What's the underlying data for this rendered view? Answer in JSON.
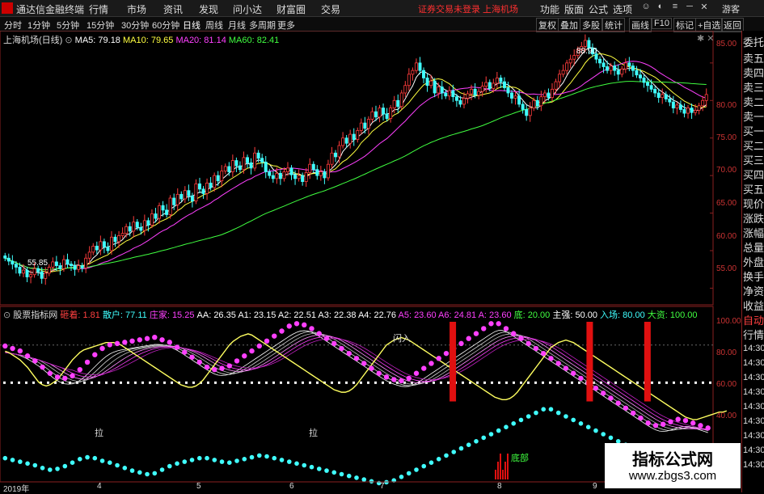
{
  "app": {
    "title": "通达信金融终端",
    "menu": [
      "行情",
      "市场",
      "资讯",
      "发现",
      "问小达",
      "财富圈",
      "交易"
    ],
    "alert": "证券交易未登录 上海机场",
    "menu_right": [
      "功能",
      "版面",
      "公式",
      "选项"
    ],
    "guest": "游客"
  },
  "toolbar": {
    "periods": [
      "分时",
      "1分钟",
      "5分钟",
      "15分钟",
      "30分钟",
      "60分钟",
      "日线",
      "周线",
      "月线",
      "多周期",
      "更多"
    ],
    "right": [
      "复权",
      "叠加",
      "多股",
      "统计",
      "画线",
      "F10",
      "标记",
      "+自选",
      "返回"
    ]
  },
  "main": {
    "title": "上海机场(日线)",
    "ma": [
      {
        "label": "MA5: 79.18",
        "color": "#ffffff"
      },
      {
        "label": "MA10: 79.65",
        "color": "#ffff40"
      },
      {
        "label": "MA20: 81.14",
        "color": "#ff40ff"
      },
      {
        "label": "MA60: 82.41",
        "color": "#40ff40"
      }
    ],
    "high_label": "88.90",
    "low_label": "55.85",
    "yticks": [
      "85.00",
      "80.00",
      "75.00",
      "70.00",
      "65.00",
      "60.00",
      "55.00"
    ]
  },
  "indicator": {
    "name": "股票指标网",
    "labels": [
      {
        "text": "砸着: 1.81",
        "color": "#ff4040"
      },
      {
        "text": "散户: 77.11",
        "color": "#40ffff"
      },
      {
        "text": "庄家: 15.25",
        "color": "#ff40ff"
      },
      {
        "text": "AA: 26.35",
        "color": "#ffffff"
      },
      {
        "text": "A1: 23.15",
        "color": "#ffffff"
      },
      {
        "text": "A2: 22.51",
        "color": "#ffffff"
      },
      {
        "text": "A3: 22.38",
        "color": "#ffffff"
      },
      {
        "text": "A4: 22.76",
        "color": "#ffffff"
      },
      {
        "text": "A5: 23.60",
        "color": "#ff40ff"
      },
      {
        "text": "A6: 24.81",
        "color": "#ff40ff"
      },
      {
        "text": "A: 23.60",
        "color": "#ff40ff"
      },
      {
        "text": "底: 20.00",
        "color": "#40ff40"
      },
      {
        "text": "主强: 50.00",
        "color": "#ffffff"
      },
      {
        "text": "入场: 80.00",
        "color": "#40ffff"
      },
      {
        "text": "大资: 100.00",
        "color": "#40ff40"
      }
    ],
    "yticks": [
      "100.00",
      "80.00",
      "60.00",
      "40.00"
    ],
    "annotations": [
      "闪入",
      "拉",
      "拉",
      "底部"
    ]
  },
  "xaxis": [
    "2019年",
    "4",
    "5",
    "6",
    "7",
    "8",
    "9"
  ],
  "sidebar": [
    "委托",
    "卖五",
    "卖四",
    "卖三",
    "卖二",
    "卖一",
    "买一",
    "买二",
    "买三",
    "买四",
    "买五",
    "现价",
    "涨跌",
    "涨幅",
    "总量",
    "外盘",
    "换手",
    "净资",
    "收益",
    "自动",
    "行情",
    "14:30",
    "14:30",
    "14:30",
    "14:30",
    "14:30",
    "14:30",
    "14:30",
    "14:30",
    "14:30"
  ],
  "watermark": {
    "title": "指标公式网",
    "url": "www.zbgs3.com"
  },
  "colors": {
    "up": "#ff3c3c",
    "down": "#40ffff",
    "ma5": "#ffffff",
    "ma10": "#ffff40",
    "ma20": "#ff40ff",
    "ma60": "#40ff40"
  },
  "chart_data": {
    "type": "candlestick",
    "ylim": [
      53,
      88
    ],
    "close": [
      59.0,
      58.6,
      58.2,
      57.8,
      57.0,
      57.4,
      56.5,
      56.8,
      57.6,
      57.2,
      56.3,
      57.0,
      57.8,
      58.5,
      58.0,
      57.6,
      58.8,
      58.2,
      58.0,
      57.5,
      58.0,
      57.7,
      59.0,
      59.8,
      60.6,
      60.1,
      61.2,
      60.5,
      60.0,
      61.8,
      61.2,
      62.0,
      62.3,
      63.2,
      62.6,
      63.8,
      63.1,
      62.7,
      64.0,
      63.4,
      64.9,
      64.3,
      66.0,
      65.4,
      64.8,
      67.0,
      66.1,
      67.5,
      66.9,
      68.0,
      67.3,
      66.6,
      68.9,
      68.2,
      67.6,
      69.0,
      68.4,
      70.0,
      69.3,
      70.6,
      71.2,
      70.5,
      72.0,
      71.3,
      70.8,
      72.4,
      71.7,
      71.0,
      73.0,
      72.3,
      71.8,
      70.5,
      70.0,
      69.6,
      70.3,
      69.6,
      70.5,
      71.0,
      70.1,
      69.6,
      70.0,
      69.2,
      70.4,
      71.5,
      70.8,
      70.0,
      70.5,
      69.7,
      71.5,
      73.0,
      72.5,
      74.0,
      75.0,
      74.3,
      75.5,
      74.8,
      76.0,
      77.0,
      76.3,
      77.5,
      78.5,
      77.8,
      79.0,
      78.2,
      77.6,
      79.0,
      80.0,
      79.2,
      81.0,
      82.0,
      83.5,
      84.0,
      85.0,
      84.0,
      83.0,
      82.0,
      82.6,
      81.0,
      81.8,
      81.0,
      80.6,
      81.3,
      80.5,
      80.0,
      79.5,
      80.3,
      80.9,
      81.5,
      80.7,
      81.2,
      81.9,
      82.4,
      81.6,
      82.3,
      83.0,
      82.5,
      81.7,
      81.0,
      80.3,
      80.6,
      79.5,
      78.8,
      78.0,
      79.0,
      80.0,
      79.3,
      80.5,
      81.0,
      80.4,
      81.5,
      82.5,
      83.5,
      84.0,
      85.0,
      85.5,
      86.0,
      86.8,
      87.2,
      88.0,
      87.0,
      86.2,
      85.5,
      85.0,
      84.5,
      84.0,
      84.6,
      84.0,
      83.5,
      84.2,
      85.0,
      84.6,
      84.0,
      83.4,
      83.0,
      82.4,
      82.0,
      81.5,
      81.0,
      80.4,
      80.8,
      80.2,
      79.8,
      79.0,
      79.4,
      78.8,
      78.3,
      79.0,
      78.4,
      78.7,
      79.3,
      80.0,
      80.8
    ],
    "indicator": {
      "retail": [
        33,
        32,
        31,
        30,
        29,
        28,
        27,
        26,
        25,
        24,
        22,
        21,
        20,
        20,
        21,
        22,
        24,
        26,
        28,
        30,
        32,
        33,
        34,
        34,
        33,
        32,
        30,
        29,
        28,
        27,
        25,
        24,
        22,
        20,
        19,
        18,
        17,
        16,
        15,
        15,
        16,
        18,
        20,
        22,
        24,
        26,
        27,
        28,
        29,
        30,
        31,
        32,
        33,
        34,
        33,
        32,
        31,
        30,
        29,
        28,
        28,
        29,
        30,
        31,
        32,
        33,
        34,
        35,
        36,
        36,
        35,
        34,
        33,
        32,
        31,
        30,
        29,
        28,
        27,
        26,
        25,
        24,
        23,
        22,
        21,
        20,
        19,
        18,
        17,
        16,
        15,
        14,
        13,
        12,
        11,
        10,
        9,
        8,
        7,
        6,
        5,
        5,
        6,
        7,
        8,
        10,
        12,
        14,
        16,
        18,
        20,
        22,
        24,
        26,
        28,
        30,
        32,
        34,
        36,
        38,
        40,
        42,
        44,
        46,
        48,
        50,
        52,
        54,
        56,
        58,
        60,
        62,
        64,
        66,
        68,
        70,
        72,
        74,
        76,
        78,
        80,
        82,
        84,
        86,
        88,
        89,
        88,
        86,
        84,
        82,
        80,
        78,
        76,
        74,
        72,
        70,
        68,
        66,
        64,
        62,
        60,
        58,
        56,
        54,
        52,
        50,
        48,
        46,
        44,
        42,
        40,
        38,
        36,
        34,
        32,
        30,
        28,
        26,
        24,
        22,
        20,
        18,
        16,
        14,
        12,
        10,
        8,
        6,
        5,
        4
      ],
      "main": [
        74,
        73,
        72,
        71,
        70,
        68,
        66,
        64,
        62,
        60,
        57,
        54,
        52,
        50,
        49,
        48,
        48,
        49,
        50,
        52,
        55,
        58,
        61,
        64,
        67,
        70,
        72,
        74,
        75,
        76,
        76,
        77,
        77,
        78,
        78,
        79,
        79,
        80,
        80,
        81,
        81,
        80,
        79,
        78,
        77,
        75,
        73,
        71,
        69,
        67,
        65,
        63,
        61,
        59,
        57,
        56,
        55,
        55,
        56,
        57,
        58,
        60,
        62,
        64,
        66,
        68,
        70,
        72,
        74,
        76,
        78,
        80,
        82,
        84,
        86,
        88,
        90,
        91,
        92,
        92,
        91,
        90,
        88,
        86,
        84,
        82,
        80,
        78,
        76,
        74,
        72,
        70,
        68,
        66,
        64,
        62,
        60,
        58,
        56,
        54,
        52,
        50,
        49,
        48,
        47,
        46,
        46,
        47,
        48,
        50,
        52,
        54,
        56,
        58,
        60,
        62,
        64,
        66,
        68,
        70,
        72,
        74,
        76,
        78,
        80,
        82,
        84,
        86,
        88,
        90,
        92,
        93,
        92,
        90,
        88,
        86,
        84,
        82,
        80,
        78,
        76,
        74,
        72,
        70,
        68,
        66,
        64,
        62,
        60,
        58,
        56,
        54,
        52,
        50,
        48,
        46,
        44,
        42,
        40,
        38,
        36,
        34,
        32,
        30,
        28,
        26,
        24,
        22,
        20,
        18,
        16,
        14,
        12,
        11,
        10,
        10,
        11,
        12,
        13,
        14,
        15,
        15,
        14,
        13,
        12,
        11,
        10,
        9,
        8
      ],
      "aa": [
        75,
        74,
        72,
        70,
        68,
        65,
        62,
        58,
        54,
        50,
        48,
        47,
        48,
        50,
        52,
        56,
        60,
        64,
        68,
        71,
        74,
        76,
        77,
        78,
        79,
        80,
        81,
        82,
        82,
        82,
        81,
        80,
        78,
        76,
        74,
        72,
        70,
        68,
        66,
        64,
        62,
        60,
        58,
        56,
        54,
        52,
        50,
        48,
        47,
        46,
        46,
        47,
        49,
        52,
        56,
        60,
        64,
        68,
        72,
        76,
        80,
        83,
        85,
        87,
        88,
        89,
        88,
        86,
        84,
        82,
        80,
        78,
        76,
        74,
        72,
        70,
        68,
        66,
        64,
        62,
        60,
        58,
        56,
        54,
        52,
        50,
        48,
        46,
        44,
        43,
        42,
        42,
        43,
        45,
        48,
        52,
        56,
        60,
        64,
        68,
        72,
        76,
        80,
        82,
        84,
        85,
        86,
        85,
        84,
        82,
        80,
        78,
        76,
        74,
        72,
        70,
        68,
        66,
        64,
        62,
        60,
        58,
        56,
        54,
        52,
        50,
        48,
        46,
        44,
        42,
        40,
        38,
        37,
        36,
        36,
        37,
        39,
        42,
        46,
        50,
        54,
        58,
        62,
        66,
        70,
        74,
        78,
        80,
        82,
        83,
        84,
        83,
        82,
        80,
        78,
        76,
        74,
        72,
        70,
        68,
        66,
        64,
        62,
        60,
        58,
        56,
        54,
        52,
        50,
        48,
        46,
        44,
        42,
        40,
        38,
        36,
        34,
        32,
        30,
        28,
        26,
        24,
        22,
        21,
        20,
        20,
        21,
        22,
        23,
        24,
        25,
        26,
        26,
        27
      ],
      "red_bars": [
        [
          0.635,
          30
        ],
        [
          0.827,
          22
        ],
        [
          0.908,
          22
        ]
      ]
    }
  }
}
